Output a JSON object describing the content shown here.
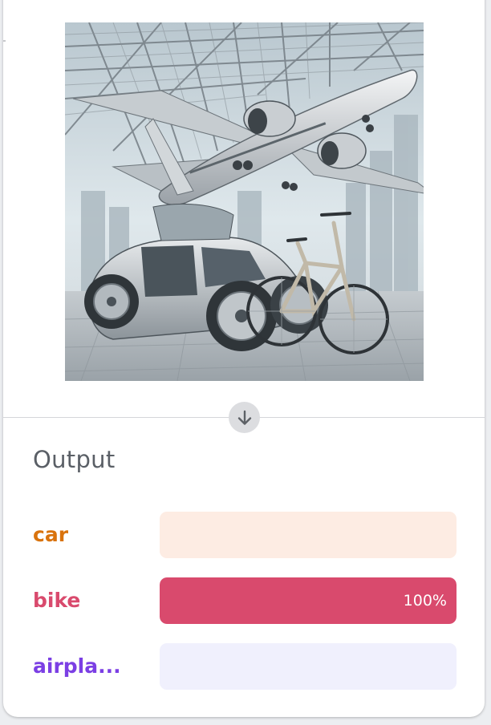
{
  "output_section": {
    "title": "Output"
  },
  "predictions": [
    {
      "label": "car",
      "score": 0.0,
      "score_text": "",
      "label_color": "#d9730d",
      "track_color": "#fdece3",
      "fill_color": "#f2a36b"
    },
    {
      "label": "bike",
      "score": 1.0,
      "score_text": "100%",
      "label_color": "#d94a6d",
      "track_color": "#fbe3e9",
      "fill_color": "#d94a6d"
    },
    {
      "label": "airpla...",
      "score": 0.0,
      "score_text": "",
      "label_color": "#7b3fe4",
      "track_color": "#f0f0fd",
      "fill_color": "#8b6cf0"
    }
  ],
  "icons": {
    "flow_arrow": "arrow-down-icon"
  }
}
